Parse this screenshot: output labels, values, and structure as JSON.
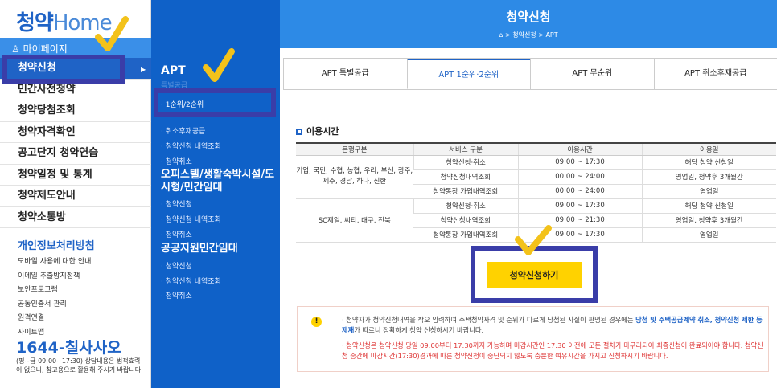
{
  "logo": {
    "cheong": "청약",
    "home": "Home"
  },
  "left": {
    "mypage": "마이페이지",
    "menu": [
      "청약신청",
      "민간사전청약",
      "청약당첨조회",
      "청약자격확인",
      "공고단지 청약연습",
      "청약일정 및 통계",
      "청약제도안내",
      "청약소통방"
    ],
    "privacy": "개인정보처리방침",
    "links": [
      "모바일 사용에 대한 안내",
      "이메일 추출방지정책",
      "보안프로그램",
      "공동인증서 관리",
      "원격연결",
      "사이트맵"
    ],
    "phone": "1644-칠사사오",
    "phone_note": "(평~금 09:00~17:30) 상담내용은 법적효력이 없으니, 참고용으로 활용해 주시기 바랍니다."
  },
  "mega": {
    "apt": "APT",
    "apt_cut": "특별공급",
    "apt_items": [
      "· 1순위/2순위",
      "· 취소후재공급",
      "· 청약신청 내역조회",
      "· 청약취소"
    ],
    "officetel": "오피스텔/생활숙박시설/도시형/민간임대",
    "officetel_items": [
      "· 청약신청",
      "· 청약신청 내역조회",
      "· 청약취소"
    ],
    "public": "공공지원민간임대",
    "public_items": [
      "· 청약신청",
      "· 청약신청 내역조회",
      "· 청약취소"
    ]
  },
  "banner": {
    "title": "청약신청",
    "breadcrumb": "⌂  >  청약신청  >  APT"
  },
  "tabs": [
    "APT 특별공급",
    "APT 1순위·2순위",
    "APT 무순위",
    "APT 취소후재공급"
  ],
  "section": "이용시간",
  "table": {
    "headers": [
      "은행구분",
      "서비스 구분",
      "이용시간",
      "이용일"
    ],
    "group1": "기업, 국민, 수협, 농협, 우리, 부산, 광주, 제주, 경남, 하나, 신한",
    "group2": "SC제일, 씨티, 대구, 전북",
    "rows": [
      [
        "청약신청·취소",
        "09:00 ~ 17:30",
        "해당 청약 신청일"
      ],
      [
        "청약신청내역조회",
        "00:00 ~ 24:00",
        "영업일, 청약후 3개월간"
      ],
      [
        "청약통장 가입내역조회",
        "00:00 ~ 24:00",
        "영업일"
      ],
      [
        "청약신청·취소",
        "09:00 ~ 17:30",
        "해당 청약 신청일"
      ],
      [
        "청약신청내역조회",
        "09:00 ~ 21:30",
        "영업일, 청약후 3개월간"
      ],
      [
        "청약통장 가입내역조회",
        "09:00 ~ 17:30",
        "영업일"
      ]
    ]
  },
  "apply_button": "청약신청하기",
  "notice": {
    "p1a": "· 청약자가 청약신청내역을 착오 입력하여 주택청약자격 및 순위가 다르게 당첨된 사실이 판명된 경우에는 ",
    "p1b": "당첨 및 주택공급계약 취소,",
    "p1c": "청약신청 제한 등 제재",
    "p1d": "가 따르니 정확하게 청약 신청하시기 바랍니다.",
    "p2": "· 청약신청은 청약신청 당일 09:00부터 17:30까지 가능하며 마감시간인 17:30 이전에 모든 절차가 마무리되어 최종신청이 완료되어야 합니다. 청약신청 중간에 마감시간(17:30)경과에 따른 청약신청이 중단되지 않도록 충분한 여유시간을 가지고 신청하시기 바랍니다."
  }
}
